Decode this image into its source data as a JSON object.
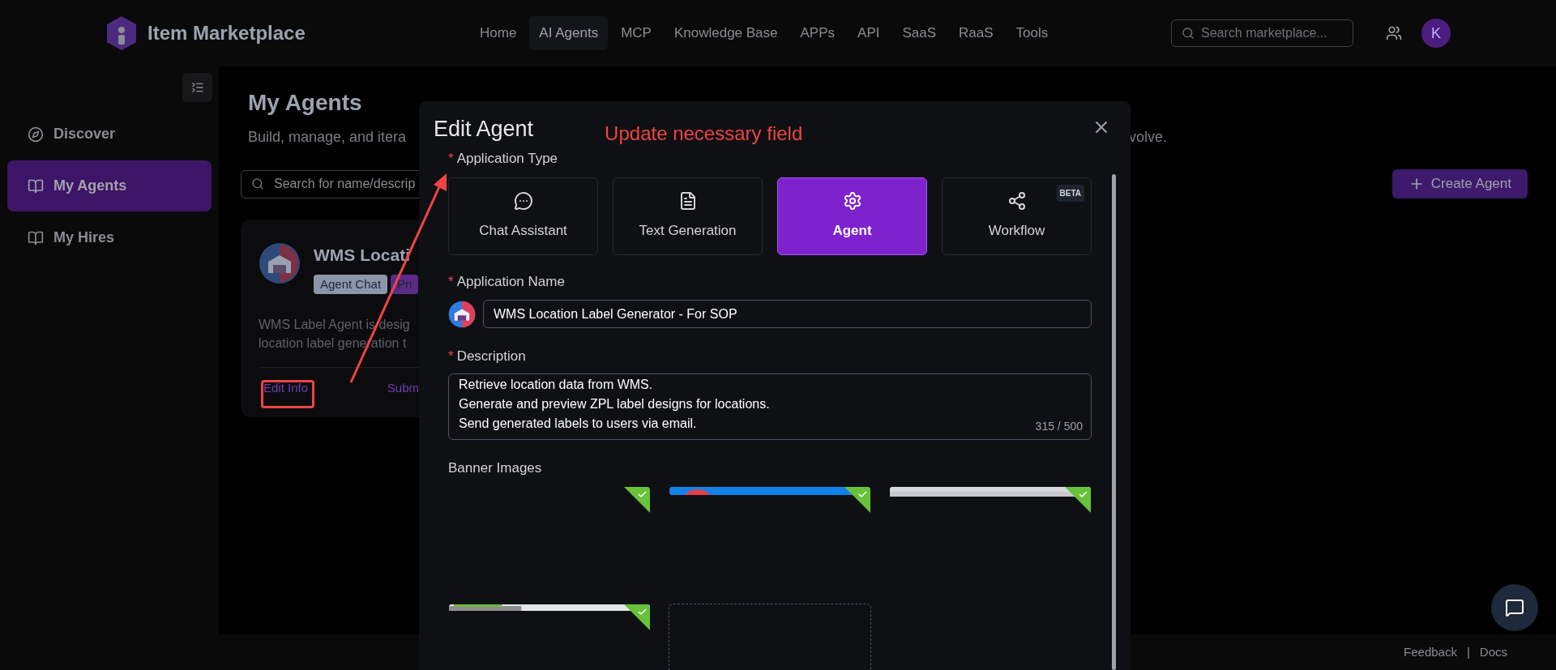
{
  "header": {
    "brand": "Item Marketplace",
    "nav": [
      {
        "label": "Home",
        "selected": false
      },
      {
        "label": "AI Agents",
        "selected": true
      },
      {
        "label": "MCP",
        "selected": false
      },
      {
        "label": "Knowledge Base",
        "selected": false
      },
      {
        "label": "APPs",
        "selected": false
      },
      {
        "label": "API",
        "selected": false
      },
      {
        "label": "SaaS",
        "selected": false
      },
      {
        "label": "RaaS",
        "selected": false
      },
      {
        "label": "Tools",
        "selected": false
      }
    ],
    "search": {
      "placeholder": "Search marketplace..."
    },
    "avatar": "K"
  },
  "sidebar": {
    "items": [
      {
        "label": "Discover",
        "kind": "compass",
        "selected": false
      },
      {
        "label": "My Agents",
        "kind": "book",
        "selected": true
      },
      {
        "label": "My Hires",
        "kind": "book",
        "selected": false
      }
    ]
  },
  "page": {
    "title": "My Agents",
    "subtitle_start": "Build, manage, and itera",
    "subtitle_end": "volve.",
    "search": {
      "placeholder": "Search for name/descrip"
    },
    "create_button": "Create Agent",
    "card": {
      "title": "WMS Locati",
      "tags": [
        {
          "label": "Agent Chat",
          "color": "#8b96a8"
        },
        {
          "label": "Pri",
          "color": "#5b2a86"
        }
      ],
      "description": [
        "WMS Label Agent is desig",
        "location label generation t"
      ],
      "actions": [
        "Edit Info",
        "Subm"
      ]
    }
  },
  "footer": {
    "links": [
      "Feedback",
      "Docs"
    ],
    "separator": "|"
  },
  "annotation": {
    "text": "Update necessary field"
  },
  "dialog": {
    "title": "Edit Agent",
    "application_type": {
      "required_mark": "*",
      "label": "Application Type",
      "options": [
        {
          "label": "Chat Assistant",
          "kind": "chat",
          "selected": false
        },
        {
          "label": "Text Generation",
          "kind": "document",
          "selected": false
        },
        {
          "label": "Agent",
          "kind": "gear",
          "selected": true
        },
        {
          "label": "Workflow",
          "kind": "share",
          "selected": false,
          "badge": "BETA"
        }
      ]
    },
    "application_name": {
      "required_mark": "*",
      "label": "Application Name",
      "value": "WMS Location Label Generator - For SOP"
    },
    "description": {
      "required_mark": "*",
      "label": "Description",
      "lines": [
        "Retrieve location data from WMS.",
        "Generate and preview ZPL label designs for locations.",
        "Send generated labels to users via email."
      ],
      "counter": "315 / 500"
    },
    "banner_images": {
      "label": "Banner Images",
      "items": [
        {
          "kind": "blank",
          "selected": true
        },
        {
          "kind": "blue",
          "selected": true
        },
        {
          "kind": "grey",
          "selected": true
        },
        {
          "kind": "grey_green",
          "selected": true
        },
        {
          "kind": "upload",
          "selected": false
        }
      ]
    }
  }
}
